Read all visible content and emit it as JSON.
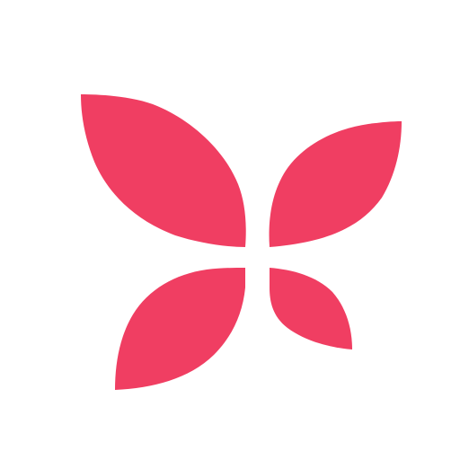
{
  "logo": {
    "icon": "butterfly-petal-logo",
    "color": "#F03E62",
    "background": "#FFFFFF"
  }
}
